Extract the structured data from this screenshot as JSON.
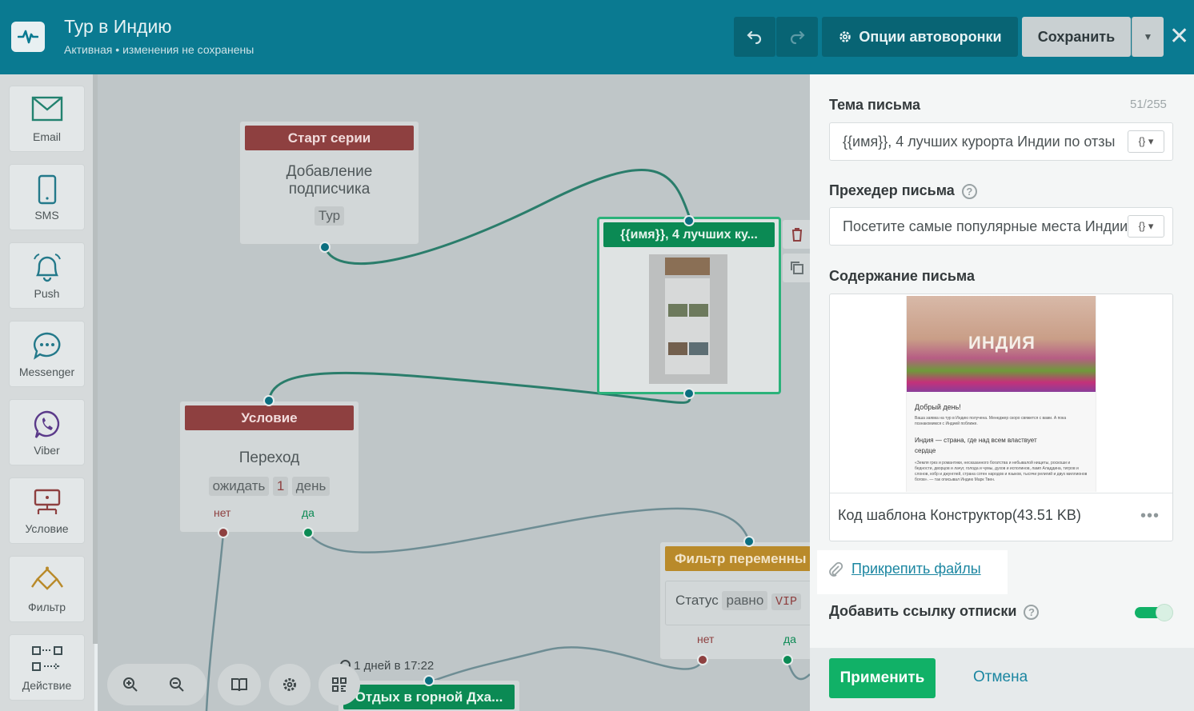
{
  "header": {
    "title": "Тур в Индию",
    "status": "Активная",
    "status_sep": "•",
    "status_note": "изменения не сохранены",
    "options_label": "Опции автоворонки",
    "save_label": "Сохранить",
    "close_symbol": "✕"
  },
  "sidebar": {
    "items": [
      {
        "label": "Email"
      },
      {
        "label": "SMS"
      },
      {
        "label": "Push"
      },
      {
        "label": "Messenger"
      },
      {
        "label": "Viber"
      },
      {
        "label": "Условие"
      },
      {
        "label": "Фильтр"
      },
      {
        "label": "Действие"
      }
    ]
  },
  "canvas": {
    "start_node": {
      "head": "Старт серии",
      "title_line1": "Добавление",
      "title_line2": "подписчика",
      "tag": "Тур"
    },
    "email_node": {
      "head": "{{имя}}, 4 лучших ку..."
    },
    "condition_node": {
      "head": "Условие",
      "title": "Переход",
      "wait": "ожидать",
      "num": "1",
      "unit": "день",
      "no": "нет",
      "yes": "да"
    },
    "filter_node": {
      "head": "Фильтр переменны",
      "field": "Статус",
      "op": "равно",
      "value": "VIP",
      "no": "нет",
      "yes": "да"
    },
    "timer": "1 дней в 17:22",
    "bottom_node": {
      "head": "Отдых в горной Дха..."
    }
  },
  "panel": {
    "subject_label": "Тема письма",
    "subject_counter": "51/255",
    "subject_value": "{{имя}}, 4 лучших курорта Индии по отзы",
    "preheader_label": "Прехедер письма",
    "preheader_value": "Посетите самые популярные места Индии",
    "var_button": "{}",
    "content_label": "Содержание письма",
    "preview": {
      "hero_text": "ИНДИЯ",
      "greeting": "Добрый день!",
      "intro": "Ваша заявка на тур в Индию получена. Менеджер скоро свяжется с вами. А пока познакомимся с Индией поближе.",
      "heading_line1": "Индия — страна, где над всем властвует",
      "heading_line2": "сердце",
      "body": "«Земля грез и романтики, несказанного богатства и небывалой нищеты, роскоши и бедности, дворцов и лачуг, голода и чумы, духов и исполинов, ламп Аладдина, тигров и слонов, кобр и джунглей, страна сотен народов и языков, тысячи религий и двух миллионов богов». — так описывал Индию Марк Твен."
    },
    "template_label": "Код шаблона Конструктор(43.51 KB)",
    "attach_label": "Прикрепить файлы",
    "unsubscribe_label": "Добавить ссылку отписки",
    "apply_label": "Применить",
    "cancel_label": "Отмена"
  },
  "colors": {
    "header": "#0a7a91",
    "accent_green": "#11b167",
    "link": "#1b86a1",
    "node_red": "#8e4040",
    "node_green": "#0b8a54",
    "node_orange": "#b98a2a"
  }
}
